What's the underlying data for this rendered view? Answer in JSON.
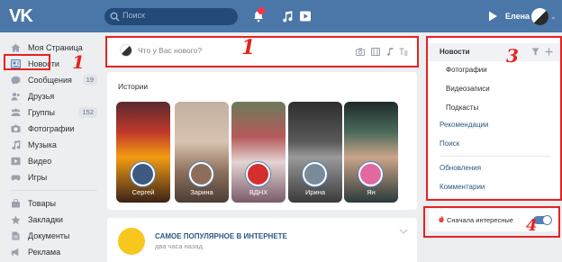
{
  "header": {
    "search_placeholder": "Поиск",
    "notifications_badge": "",
    "user_name": "Елена"
  },
  "left_menu": {
    "items": [
      {
        "label": "Моя Страница",
        "icon": "home-icon",
        "count": ""
      },
      {
        "label": "Новости",
        "icon": "news-icon",
        "count": ""
      },
      {
        "label": "Сообщения",
        "icon": "messages-icon",
        "count": "19"
      },
      {
        "label": "Друзья",
        "icon": "friends-icon",
        "count": ""
      },
      {
        "label": "Группы",
        "icon": "groups-icon",
        "count": "152"
      },
      {
        "label": "Фотографии",
        "icon": "camera-icon",
        "count": ""
      },
      {
        "label": "Музыка",
        "icon": "music-icon",
        "count": ""
      },
      {
        "label": "Видео",
        "icon": "video-icon",
        "count": ""
      },
      {
        "label": "Игры",
        "icon": "games-icon",
        "count": ""
      }
    ],
    "items2": [
      {
        "label": "Товары",
        "icon": "goods-icon"
      },
      {
        "label": "Закладки",
        "icon": "bookmark-icon"
      },
      {
        "label": "Документы",
        "icon": "document-icon"
      },
      {
        "label": "Реклама",
        "icon": "ads-icon"
      }
    ]
  },
  "post_box": {
    "placeholder": "Что у Вас нового?"
  },
  "stories": {
    "title": "Истории",
    "items": [
      {
        "name": "Сергей"
      },
      {
        "name": "Зарина"
      },
      {
        "name": "ВДНХ"
      },
      {
        "name": "Ирина"
      },
      {
        "name": "Ян"
      }
    ]
  },
  "feed_item": {
    "title": "САМОЕ ПОПУЛЯРНОЕ В ИНТЕРНЕТЕ",
    "time": "два часа назад"
  },
  "right_menu": {
    "selected": "Новости",
    "sub_items": [
      "Фотографии",
      "Видеозаписи",
      "Подкасты"
    ],
    "items": [
      "Рекомендации",
      "Поиск"
    ],
    "items2": [
      "Обновления",
      "Комментарии"
    ]
  },
  "toggle": {
    "label": "Сначала интересные",
    "state": "on"
  },
  "annotations": {
    "mark1": "1",
    "mark2": "1",
    "mark3": "3",
    "mark4": "4"
  },
  "colors": {
    "header": "#4a76a8",
    "accent": "#5181b8",
    "annotation": "#e52322"
  }
}
